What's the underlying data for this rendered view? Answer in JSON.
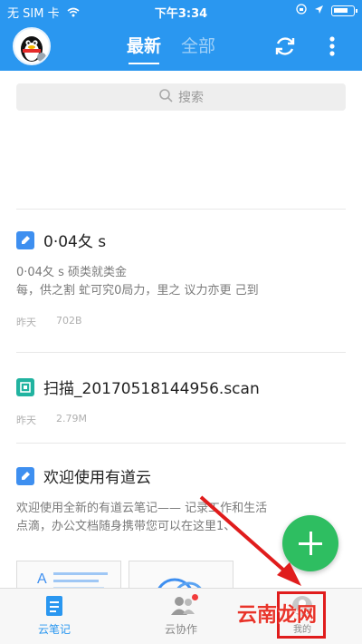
{
  "status_bar": {
    "carrier": "无 SIM 卡",
    "time": "下午3:34"
  },
  "header": {
    "tabs": [
      {
        "label": "最新",
        "active": true
      },
      {
        "label": "全部",
        "active": false
      }
    ]
  },
  "search": {
    "placeholder": "搜索"
  },
  "notes": [
    {
      "title": "0·04夂 s",
      "preview_line1": "0·04夂 s  硕类就类金",
      "preview_line2": "每，供之割  虻可究0局力，里之  议力亦更  己到",
      "date": "昨天",
      "size": "702B",
      "icon": "note-icon"
    },
    {
      "title": "扫描_20170518144956.scan",
      "date": "昨天",
      "size": "2.79M",
      "icon": "scan-icon"
    },
    {
      "title": "欢迎使用有道云",
      "preview_line1": "欢迎使用全新的有道云笔记—— 记录工作和生活",
      "preview_line2": "点滴，办公文档随身携带您可以在这里1、",
      "icon": "note-icon"
    }
  ],
  "bottom_nav": [
    {
      "label": "云笔记",
      "active": true
    },
    {
      "label": "云协作",
      "active": false
    },
    {
      "label": "我的",
      "active": false
    }
  ],
  "watermark": "云南龙网",
  "colors": {
    "header_blue": "#2a97f0",
    "fab_green": "#2ebe61",
    "highlight_red": "#e01c1c",
    "note_icon_blue": "#3e8ff0",
    "scan_icon_teal": "#21b3a0"
  }
}
